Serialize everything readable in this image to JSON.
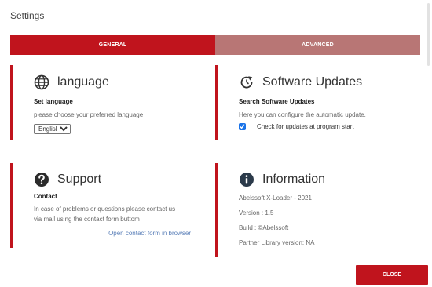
{
  "window": {
    "title": "Settings"
  },
  "tabs": [
    {
      "label": "GENERAL",
      "active": true
    },
    {
      "label": "ADVANCED",
      "active": false
    }
  ],
  "language": {
    "icon": "globe-icon",
    "title": "language",
    "subtitle": "Set language",
    "description": "please choose your preferred language",
    "selected": "English"
  },
  "updates": {
    "icon": "refresh-clock-icon",
    "title": "Software Updates",
    "subtitle": "Search Software Updates",
    "description": "Here you can configure the automatic update.",
    "check_label": "Check for updates at program start",
    "checked": true
  },
  "support": {
    "icon": "question-circle-icon",
    "title": "Support",
    "subtitle": "Contact",
    "description_line1": "In case of problems or questions please contact us",
    "description_line2": "via mail using the contact form buttom",
    "link": "Open contact form in browser"
  },
  "information": {
    "icon": "info-circle-icon",
    "title": "Information",
    "product": "Abelssoft X-Loader - 2021",
    "version": "Version : 1.5",
    "build": "Build : ©Abelssoft",
    "partner": "Partner Library version: NA"
  },
  "footer": {
    "close_label": "CLOSE"
  },
  "colors": {
    "accent": "#c0141d",
    "inactive_tab": "#b87675",
    "link": "#5a7fb8"
  }
}
